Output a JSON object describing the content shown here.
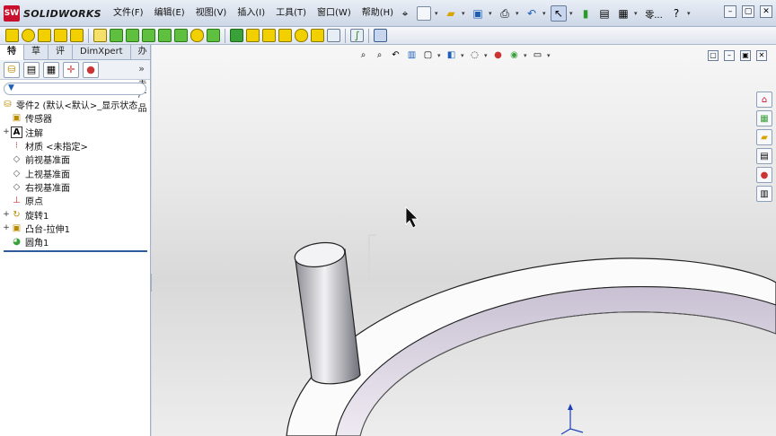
{
  "app": {
    "logo_mark": "SW",
    "logo_text": "SOLIDWORKS"
  },
  "menus": [
    "文件(F)",
    "编辑(E)",
    "视图(V)",
    "插入(I)",
    "工具(T)",
    "窗口(W)",
    "帮助(H)"
  ],
  "title_right": {
    "extra_label": "零...",
    "help_label": "?"
  },
  "window_controls": {
    "minimize": "–",
    "restore": "▢",
    "close": "✕"
  },
  "panel": {
    "tabs": [
      "特征",
      "草图",
      "评估",
      "DimXpert",
      "办公室产品"
    ],
    "active_tab": 0,
    "more_label": "»",
    "tree": [
      {
        "label": "零件2  (默认<默认>_显示状态",
        "icon": "part-icon",
        "expand": ""
      },
      {
        "label": "传感器",
        "icon": "sensor-icon",
        "expand": ""
      },
      {
        "label": "注解",
        "icon": "annotation-icon",
        "expand": "+"
      },
      {
        "label": "材质 <未指定>",
        "icon": "material-icon",
        "expand": ""
      },
      {
        "label": "前视基准面",
        "icon": "plane-icon",
        "expand": ""
      },
      {
        "label": "上视基准面",
        "icon": "plane-icon",
        "expand": ""
      },
      {
        "label": "右视基准面",
        "icon": "plane-icon",
        "expand": ""
      },
      {
        "label": "原点",
        "icon": "origin-icon",
        "expand": ""
      },
      {
        "label": "旋转1",
        "icon": "revolve-icon",
        "expand": "+"
      },
      {
        "label": "凸台-拉伸1",
        "icon": "extrude-icon",
        "expand": "+"
      },
      {
        "label": "圆角1",
        "icon": "fillet-icon",
        "expand": ""
      }
    ]
  },
  "colors": {
    "accent": "#2f5b9a",
    "brand": "#c8102e",
    "feature_icon": "#e8c800"
  }
}
